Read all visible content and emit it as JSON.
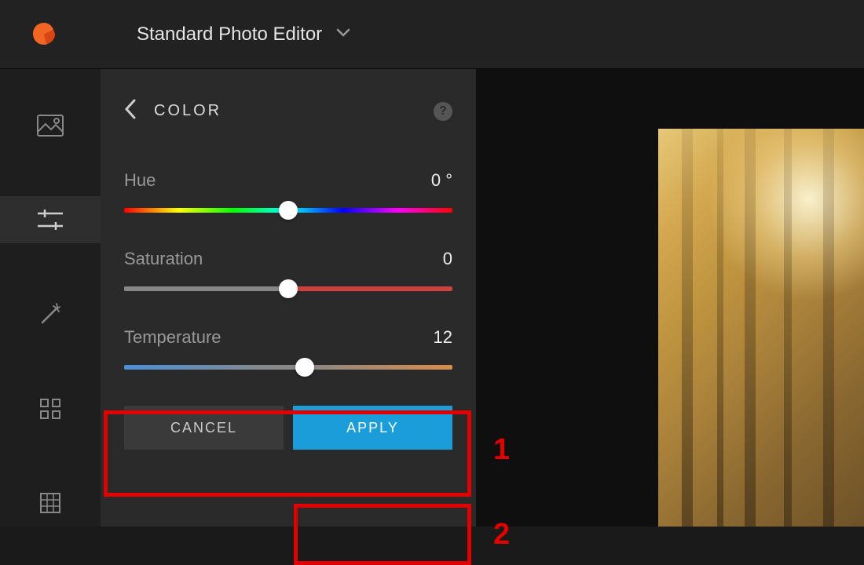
{
  "header": {
    "app_title": "Standard Photo Editor"
  },
  "panel": {
    "title": "COLOR",
    "sliders": {
      "hue": {
        "label": "Hue",
        "value": "0 °",
        "thumb_pct": 50
      },
      "saturation": {
        "label": "Saturation",
        "value": "0",
        "thumb_pct": 50
      },
      "temperature": {
        "label": "Temperature",
        "value": "12",
        "thumb_pct": 55
      }
    },
    "buttons": {
      "cancel": "CANCEL",
      "apply": "APPLY"
    }
  },
  "annotations": {
    "num1": "1",
    "num2": "2"
  }
}
